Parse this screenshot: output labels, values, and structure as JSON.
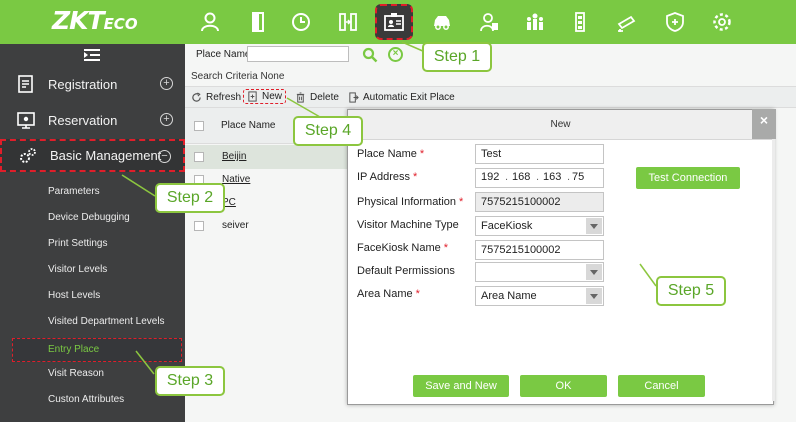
{
  "app": {
    "logo_main": "ZKT",
    "logo_suffix": "ECO"
  },
  "colors": {
    "brand_green": "#7ac943",
    "sidebar_bg": "#3e3f40",
    "highlight_red": "#e01e2a",
    "step_text": "#5aa628"
  },
  "top_nav": {
    "icons": [
      "person-icon",
      "door-icon",
      "clock-icon",
      "attendance-icon",
      "visitor-badge-icon",
      "car-icon",
      "patrol-guard-icon",
      "people-group-icon",
      "elevator-icon",
      "camera-icon",
      "shield-icon",
      "gear-icon"
    ],
    "active_icon": "visitor-badge-icon"
  },
  "sidebar": {
    "modules": [
      {
        "label": "Registration",
        "icon": "registration-icon",
        "expand": "+"
      },
      {
        "label": "Reservation",
        "icon": "reservation-icon",
        "expand": "+"
      },
      {
        "label": "Basic Management",
        "icon": "gears-icon",
        "expand": "−"
      }
    ],
    "sub_items": [
      "Parameters",
      "Device Debugging",
      "Print Settings",
      "Visitor Levels",
      "Host Levels",
      "Visited Department Levels",
      "Entry Place",
      "Visit Reason",
      "Custon Attributes"
    ],
    "active_sub": "Entry Place"
  },
  "search": {
    "label": "Place Name",
    "value": "",
    "criteria": "Search Criteria None"
  },
  "toolbar": {
    "refresh": "Refresh",
    "new": "New",
    "delete": "Delete",
    "auto_exit": "Automatic Exit Place"
  },
  "list": {
    "column": "Place Name",
    "rows": [
      "Beijin",
      "Native",
      "PC",
      "seiver"
    ]
  },
  "dialog": {
    "title": "New",
    "close": "×",
    "fields": {
      "place_name": {
        "label": "Place Name",
        "required": "*",
        "value": "Test"
      },
      "ip_address": {
        "label": "IP Address",
        "required": "*",
        "segments": [
          "192",
          "168",
          "163",
          "75"
        ]
      },
      "physical_info": {
        "label": "Physical Information",
        "required": "*",
        "value": "7575215100002"
      },
      "visitor_machine_type": {
        "label": "Visitor Machine Type",
        "value": "FaceKiosk"
      },
      "facekiosk_name": {
        "label": "FaceKiosk Name",
        "required": "*",
        "value": "7575215100002"
      },
      "default_permissions": {
        "label": "Default Permissions",
        "value": ""
      },
      "area_name": {
        "label": "Area Name",
        "required": "*",
        "value": "Area Name"
      }
    },
    "test_connection": "Test Connection",
    "save_and_new": "Save and New",
    "ok": "OK",
    "cancel": "Cancel"
  },
  "callouts": {
    "step1": "Step 1",
    "step2": "Step 2",
    "step3": "Step 3",
    "step4": "Step 4",
    "step5": "Step 5"
  }
}
